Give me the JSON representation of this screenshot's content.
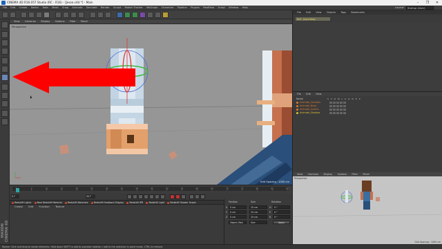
{
  "window": {
    "title": "CINEMA 4D R16.057 Studio (RC - R16) - [Jesse.c4d *] - Main",
    "controls": [
      "–",
      "❐",
      "✕"
    ]
  },
  "menubar": [
    "File",
    "Edit",
    "Create",
    "Select",
    "Tools",
    "Mesh",
    "Snap",
    "Animate",
    "Simulate",
    "Render",
    "Sculpt",
    "Motion Tracker",
    "MoGraph",
    "Character",
    "Pipeline",
    "Plugins",
    "RealFlow",
    "Script",
    "Window",
    "Help"
  ],
  "layout": {
    "label": "Layout:",
    "value": "Startup (User)"
  },
  "viewport": {
    "menu": [
      "View",
      "Cameras",
      "Display",
      "Options",
      "Filter",
      "Panel"
    ],
    "label": "Perspective",
    "grid_spacing": "Grid Spacing : 1000 cm"
  },
  "timeline": {
    "ticks": [
      "0",
      "5",
      "10",
      "15",
      "20",
      "25",
      "30",
      "35",
      "40",
      "45",
      "50",
      "55",
      "60",
      "65",
      "70",
      "75",
      "80",
      "85",
      "90"
    ],
    "start_frame": "0 F",
    "end_frame": "90 F"
  },
  "plugins_bar": [
    "Redshift Lights",
    "New Redshift Material",
    "Redshift Materials",
    "Redshift Feedback Display",
    "Redshift IPR",
    "Redshift Light",
    "Redshift Shader Graph"
  ],
  "material_manager": {
    "menu": [
      "Create",
      "Edit",
      "Function",
      "Texture"
    ]
  },
  "coordinates": {
    "headers": [
      "Position",
      "Size",
      "Rotation"
    ],
    "rows": [
      {
        "axis": "X",
        "pos": "0 cm",
        "size": "15 cm",
        "rot_axis": "H",
        "rot": "0 °"
      },
      {
        "axis": "Y",
        "pos": "0 cm",
        "size": "15 cm",
        "rot_axis": "P",
        "rot": "0 °"
      },
      {
        "axis": "Z",
        "pos": "0 cm",
        "size": "15 cm",
        "rot_axis": "B",
        "rot": "0 °"
      }
    ],
    "mode": "Object (Rel)",
    "size_mode": "Size",
    "apply": "Apply"
  },
  "status": "Rotate: Click and drag to rotate elements. Hold down SHIFT to add to quantize rotation / add to the selection in point mode, CTRL to remove.",
  "logo": "MAXON CINEMA 4D",
  "objects_panel": {
    "menu": [
      "File",
      "Edit",
      "View",
      "Objects",
      "Tags",
      "Bookmarks"
    ],
    "selected_item": "Null - Jesse Body"
  },
  "layers_panel": {
    "menu": [
      "File",
      "Edit",
      "View"
    ],
    "header": "Name",
    "columns": [
      "S",
      "V",
      "R",
      "M",
      "L",
      "A",
      "G",
      "D",
      "E",
      "X"
    ],
    "items": [
      {
        "name": "Animate_Controls",
        "color": "#e07a2e"
      },
      {
        "name": "Animate_Body",
        "color": "#e07a2e"
      },
      {
        "name": "Animate_Inverts",
        "color": "#e07a2e"
      },
      {
        "name": "Animate_Shadow",
        "color": "#e0c22e"
      }
    ]
  },
  "mini_viewport": {
    "menu": [
      "View",
      "Cameras",
      "Display",
      "Options",
      "Filter",
      "Panel"
    ],
    "label": "Perspective",
    "grid_spacing": "Grid Spacing : 1000 cm"
  },
  "colors": {
    "arrow": "#ff0000",
    "viewport_bg": "#969696",
    "accent": "#e07a2e"
  }
}
